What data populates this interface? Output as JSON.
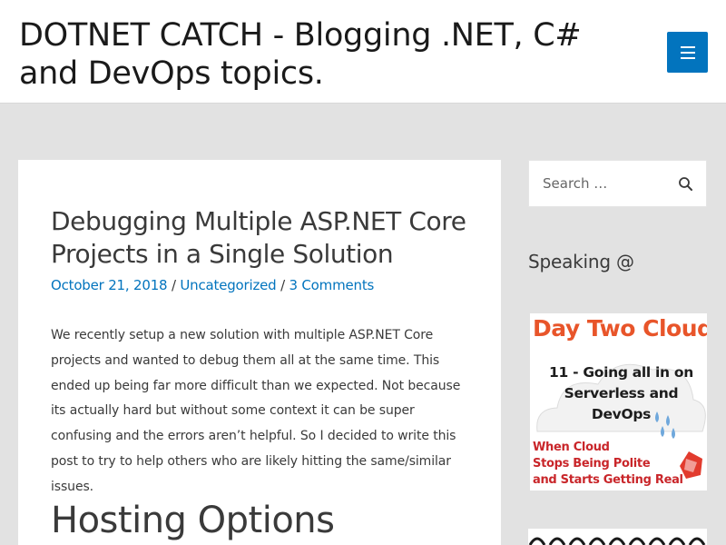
{
  "header": {
    "site_title": "DOTNET CATCH - Blogging .NET, C# and DevOps topics."
  },
  "post": {
    "title": "Debugging Multiple ASP.NET Core Projects in a Single Solution",
    "date": "October 21, 2018",
    "separator": " / ",
    "category": "Uncategorized",
    "comments": "3 Comments",
    "body": "We recently setup a new solution with multiple ASP.NET Core projects and wanted to debug them all at the same time.  This ended up being far more difficult than we expected.  Not because its actually hard but without some context it can be super confusing and the errors aren’t helpful.  So I decided to write this post to try to help others who are likely hitting the same/similar issues.",
    "section_heading": "Hosting Options"
  },
  "sidebar": {
    "search": {
      "placeholder": "Search …"
    },
    "speaking_title": "Speaking @",
    "podcast": {
      "title": "Day Two Cloud",
      "episode": "11 - Going all in on Serverless and DevOps",
      "subtitle_line1": "When Cloud",
      "subtitle_line2": "Stops Being Polite",
      "subtitle_line3": "and Starts Getting Real"
    }
  },
  "colors": {
    "accent": "#0274be",
    "background": "#e2e2e2",
    "podcast_orange": "#e8552a",
    "podcast_red": "#c9262a"
  }
}
